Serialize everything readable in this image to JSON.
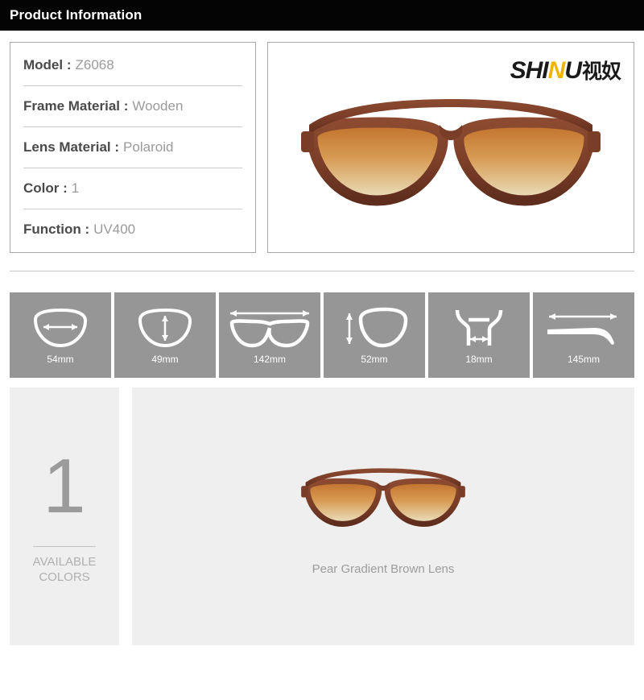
{
  "header": {
    "title": "Product Information"
  },
  "specs": {
    "rows": [
      {
        "label": "Model :",
        "value": "Z6068"
      },
      {
        "label": "Frame Material :",
        "value": "Wooden"
      },
      {
        "label": "Lens Material :",
        "value": "Polaroid"
      },
      {
        "label": "Color :",
        "value": "1"
      },
      {
        "label": "Function :",
        "value": "UV400"
      }
    ]
  },
  "brand": {
    "part_dark_1": "SHI",
    "part_gold": "N",
    "part_dark_2": "U",
    "part_cn": "视奴",
    "gold_color": "#f0b400",
    "dark_color": "#1a1a1a"
  },
  "product_image": {
    "alt": "wooden-aviator-sunglasses",
    "frame_color": "#7b3f2a",
    "lens_top_color": "#c8732c",
    "lens_bottom_color": "#e8dfc2"
  },
  "measurements": {
    "tile_background": "#969696",
    "items": [
      {
        "label": "54mm",
        "icon": "lens-width-icon"
      },
      {
        "label": "49mm",
        "icon": "lens-height-icon"
      },
      {
        "label": "142mm",
        "icon": "frame-width-icon"
      },
      {
        "label": "52mm",
        "icon": "lens-vertical-icon"
      },
      {
        "label": "18mm",
        "icon": "bridge-width-icon"
      },
      {
        "label": "145mm",
        "icon": "temple-length-icon"
      }
    ]
  },
  "colors_panel": {
    "count": "1",
    "caption_line1": "AVAILABLE",
    "caption_line2": "COLORS"
  },
  "variant_panel": {
    "caption": "Pear Gradient Brown Lens"
  }
}
